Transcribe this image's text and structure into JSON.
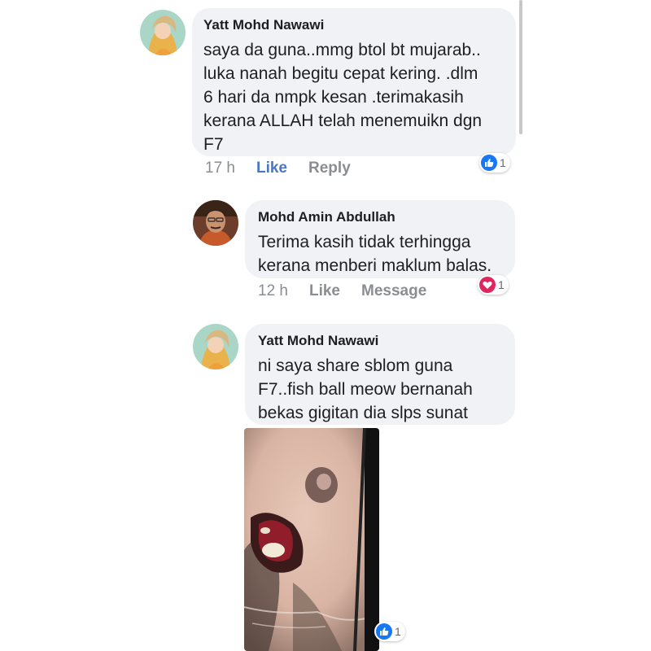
{
  "comments": [
    {
      "author": "Yatt Mohd Nawawi",
      "text": "saya da guna..mmg btol bt mujarab..\nluka nanah begitu cepat kering. .dlm\n6 hari da nmpk kesan .terimakasih\nkerana ALLAH telah menemuikn dgn\nF7",
      "time": "17 h",
      "like_label": "Like",
      "reply_label": "Reply",
      "reaction": {
        "icon": "thumbs-up-icon",
        "count": "1"
      }
    },
    {
      "author": "Mohd Amin Abdullah",
      "text": "Terima kasih tidak terhingga\nkerana menberi maklum balas.",
      "time": "12 h",
      "like_label": "Like",
      "message_label": "Message",
      "reaction": {
        "icon": "heart-icon",
        "count": "1"
      }
    },
    {
      "author": "Yatt Mohd Nawawi",
      "text": "ni saya share sblom guna\nF7..fish ball meow bernanah\nbekas gigitan dia slps sunat",
      "attachment": "photo",
      "reaction": {
        "icon": "thumbs-up-icon",
        "count": "1"
      }
    }
  ],
  "colors": {
    "bubble": "#f0f2f5",
    "like_blue": "#4a76c6",
    "meta_gray": "#8a8d91",
    "heart_red": "#e0245e"
  }
}
